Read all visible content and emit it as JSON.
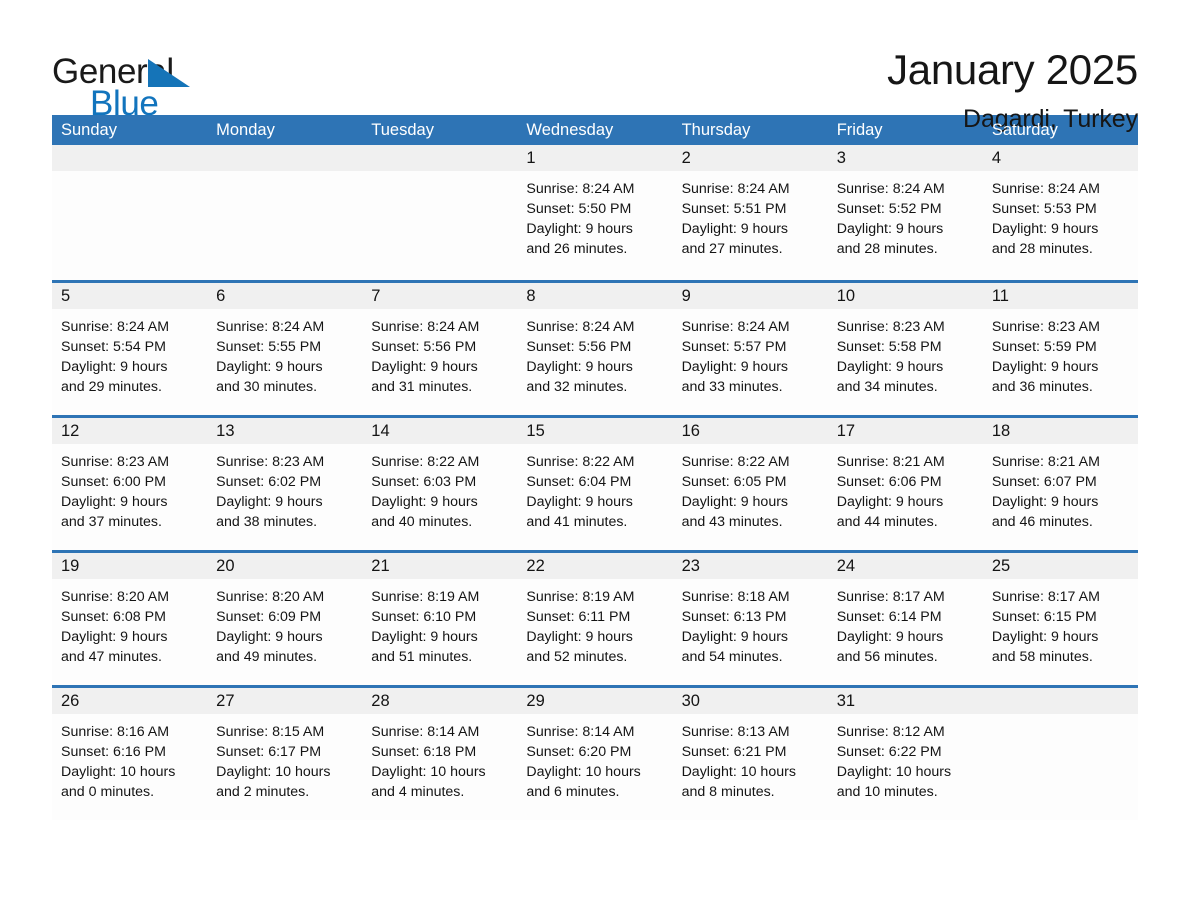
{
  "logo": {
    "word_one": "General",
    "word_two": "Blue",
    "triangle_icon": "triangle-icon",
    "brand_blue": "#1274bd"
  },
  "header": {
    "month_title": "January 2025",
    "location": "Dagardi, Turkey"
  },
  "theme": {
    "header_blue": "#2e74b5",
    "daynum_band": "#f0f0f0",
    "cell_background": "#fdfdfd"
  },
  "weekdays": [
    "Sunday",
    "Monday",
    "Tuesday",
    "Wednesday",
    "Thursday",
    "Friday",
    "Saturday"
  ],
  "weeks": [
    [
      {
        "empty": true
      },
      {
        "empty": true
      },
      {
        "empty": true
      },
      {
        "day": "1",
        "sunrise": "Sunrise: 8:24 AM",
        "sunset": "Sunset: 5:50 PM",
        "daylight_line1": "Daylight: 9 hours",
        "daylight_line2": "and 26 minutes."
      },
      {
        "day": "2",
        "sunrise": "Sunrise: 8:24 AM",
        "sunset": "Sunset: 5:51 PM",
        "daylight_line1": "Daylight: 9 hours",
        "daylight_line2": "and 27 minutes."
      },
      {
        "day": "3",
        "sunrise": "Sunrise: 8:24 AM",
        "sunset": "Sunset: 5:52 PM",
        "daylight_line1": "Daylight: 9 hours",
        "daylight_line2": "and 28 minutes."
      },
      {
        "day": "4",
        "sunrise": "Sunrise: 8:24 AM",
        "sunset": "Sunset: 5:53 PM",
        "daylight_line1": "Daylight: 9 hours",
        "daylight_line2": "and 28 minutes."
      }
    ],
    [
      {
        "day": "5",
        "sunrise": "Sunrise: 8:24 AM",
        "sunset": "Sunset: 5:54 PM",
        "daylight_line1": "Daylight: 9 hours",
        "daylight_line2": "and 29 minutes."
      },
      {
        "day": "6",
        "sunrise": "Sunrise: 8:24 AM",
        "sunset": "Sunset: 5:55 PM",
        "daylight_line1": "Daylight: 9 hours",
        "daylight_line2": "and 30 minutes."
      },
      {
        "day": "7",
        "sunrise": "Sunrise: 8:24 AM",
        "sunset": "Sunset: 5:56 PM",
        "daylight_line1": "Daylight: 9 hours",
        "daylight_line2": "and 31 minutes."
      },
      {
        "day": "8",
        "sunrise": "Sunrise: 8:24 AM",
        "sunset": "Sunset: 5:56 PM",
        "daylight_line1": "Daylight: 9 hours",
        "daylight_line2": "and 32 minutes."
      },
      {
        "day": "9",
        "sunrise": "Sunrise: 8:24 AM",
        "sunset": "Sunset: 5:57 PM",
        "daylight_line1": "Daylight: 9 hours",
        "daylight_line2": "and 33 minutes."
      },
      {
        "day": "10",
        "sunrise": "Sunrise: 8:23 AM",
        "sunset": "Sunset: 5:58 PM",
        "daylight_line1": "Daylight: 9 hours",
        "daylight_line2": "and 34 minutes."
      },
      {
        "day": "11",
        "sunrise": "Sunrise: 8:23 AM",
        "sunset": "Sunset: 5:59 PM",
        "daylight_line1": "Daylight: 9 hours",
        "daylight_line2": "and 36 minutes."
      }
    ],
    [
      {
        "day": "12",
        "sunrise": "Sunrise: 8:23 AM",
        "sunset": "Sunset: 6:00 PM",
        "daylight_line1": "Daylight: 9 hours",
        "daylight_line2": "and 37 minutes."
      },
      {
        "day": "13",
        "sunrise": "Sunrise: 8:23 AM",
        "sunset": "Sunset: 6:02 PM",
        "daylight_line1": "Daylight: 9 hours",
        "daylight_line2": "and 38 minutes."
      },
      {
        "day": "14",
        "sunrise": "Sunrise: 8:22 AM",
        "sunset": "Sunset: 6:03 PM",
        "daylight_line1": "Daylight: 9 hours",
        "daylight_line2": "and 40 minutes."
      },
      {
        "day": "15",
        "sunrise": "Sunrise: 8:22 AM",
        "sunset": "Sunset: 6:04 PM",
        "daylight_line1": "Daylight: 9 hours",
        "daylight_line2": "and 41 minutes."
      },
      {
        "day": "16",
        "sunrise": "Sunrise: 8:22 AM",
        "sunset": "Sunset: 6:05 PM",
        "daylight_line1": "Daylight: 9 hours",
        "daylight_line2": "and 43 minutes."
      },
      {
        "day": "17",
        "sunrise": "Sunrise: 8:21 AM",
        "sunset": "Sunset: 6:06 PM",
        "daylight_line1": "Daylight: 9 hours",
        "daylight_line2": "and 44 minutes."
      },
      {
        "day": "18",
        "sunrise": "Sunrise: 8:21 AM",
        "sunset": "Sunset: 6:07 PM",
        "daylight_line1": "Daylight: 9 hours",
        "daylight_line2": "and 46 minutes."
      }
    ],
    [
      {
        "day": "19",
        "sunrise": "Sunrise: 8:20 AM",
        "sunset": "Sunset: 6:08 PM",
        "daylight_line1": "Daylight: 9 hours",
        "daylight_line2": "and 47 minutes."
      },
      {
        "day": "20",
        "sunrise": "Sunrise: 8:20 AM",
        "sunset": "Sunset: 6:09 PM",
        "daylight_line1": "Daylight: 9 hours",
        "daylight_line2": "and 49 minutes."
      },
      {
        "day": "21",
        "sunrise": "Sunrise: 8:19 AM",
        "sunset": "Sunset: 6:10 PM",
        "daylight_line1": "Daylight: 9 hours",
        "daylight_line2": "and 51 minutes."
      },
      {
        "day": "22",
        "sunrise": "Sunrise: 8:19 AM",
        "sunset": "Sunset: 6:11 PM",
        "daylight_line1": "Daylight: 9 hours",
        "daylight_line2": "and 52 minutes."
      },
      {
        "day": "23",
        "sunrise": "Sunrise: 8:18 AM",
        "sunset": "Sunset: 6:13 PM",
        "daylight_line1": "Daylight: 9 hours",
        "daylight_line2": "and 54 minutes."
      },
      {
        "day": "24",
        "sunrise": "Sunrise: 8:17 AM",
        "sunset": "Sunset: 6:14 PM",
        "daylight_line1": "Daylight: 9 hours",
        "daylight_line2": "and 56 minutes."
      },
      {
        "day": "25",
        "sunrise": "Sunrise: 8:17 AM",
        "sunset": "Sunset: 6:15 PM",
        "daylight_line1": "Daylight: 9 hours",
        "daylight_line2": "and 58 minutes."
      }
    ],
    [
      {
        "day": "26",
        "sunrise": "Sunrise: 8:16 AM",
        "sunset": "Sunset: 6:16 PM",
        "daylight_line1": "Daylight: 10 hours",
        "daylight_line2": "and 0 minutes."
      },
      {
        "day": "27",
        "sunrise": "Sunrise: 8:15 AM",
        "sunset": "Sunset: 6:17 PM",
        "daylight_line1": "Daylight: 10 hours",
        "daylight_line2": "and 2 minutes."
      },
      {
        "day": "28",
        "sunrise": "Sunrise: 8:14 AM",
        "sunset": "Sunset: 6:18 PM",
        "daylight_line1": "Daylight: 10 hours",
        "daylight_line2": "and 4 minutes."
      },
      {
        "day": "29",
        "sunrise": "Sunrise: 8:14 AM",
        "sunset": "Sunset: 6:20 PM",
        "daylight_line1": "Daylight: 10 hours",
        "daylight_line2": "and 6 minutes."
      },
      {
        "day": "30",
        "sunrise": "Sunrise: 8:13 AM",
        "sunset": "Sunset: 6:21 PM",
        "daylight_line1": "Daylight: 10 hours",
        "daylight_line2": "and 8 minutes."
      },
      {
        "day": "31",
        "sunrise": "Sunrise: 8:12 AM",
        "sunset": "Sunset: 6:22 PM",
        "daylight_line1": "Daylight: 10 hours",
        "daylight_line2": "and 10 minutes."
      },
      {
        "empty": true
      }
    ]
  ]
}
